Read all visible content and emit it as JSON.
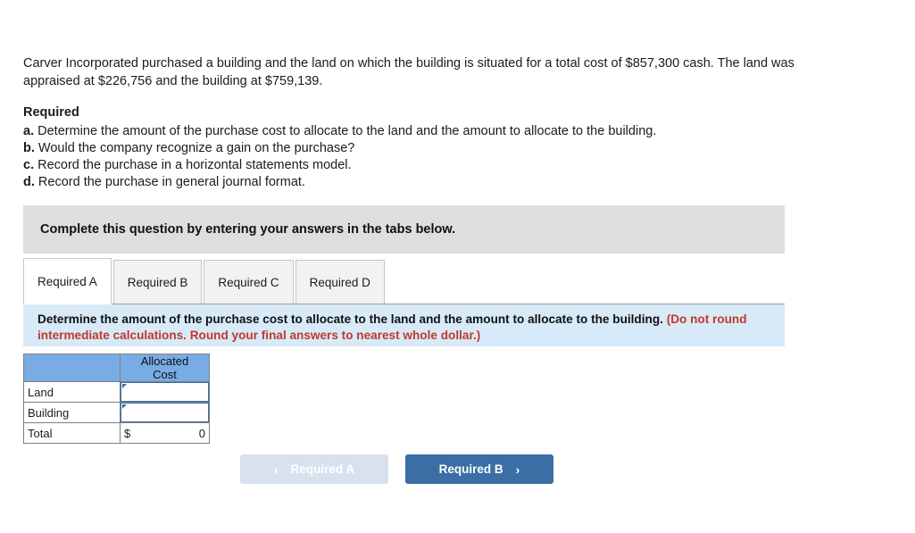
{
  "problem": {
    "text": "Carver Incorporated purchased a building and the land on which the building is situated for a total cost of $857,300 cash. The land was appraised at $226,756 and the building at $759,139."
  },
  "required": {
    "title": "Required",
    "items": [
      {
        "letter": "a.",
        "text": "Determine the amount of the purchase cost to allocate to the land and the amount to allocate to the building."
      },
      {
        "letter": "b.",
        "text": "Would the company recognize a gain on the purchase?"
      },
      {
        "letter": "c.",
        "text": "Record the purchase in a horizontal statements model."
      },
      {
        "letter": "d.",
        "text": "Record the purchase in general journal format."
      }
    ]
  },
  "instruction_bar": {
    "text": "Complete this question by entering your answers in the tabs below."
  },
  "tabs": [
    {
      "label": "Required A",
      "active": true
    },
    {
      "label": "Required B",
      "active": false
    },
    {
      "label": "Required C",
      "active": false
    },
    {
      "label": "Required D",
      "active": false
    }
  ],
  "info_panel": {
    "main_text": "Determine the amount of the purchase cost to allocate to the land and the amount to allocate to the building.",
    "note_text": "(Do not round intermediate calculations. Round your final answers to nearest whole dollar.)",
    "note_color": "#c0392b"
  },
  "answer_table": {
    "header": {
      "blank": "",
      "allocated_cost_line1": "Allocated",
      "allocated_cost_line2": "Cost"
    },
    "rows": [
      {
        "label": "Land",
        "value": "",
        "type": "input"
      },
      {
        "label": "Building",
        "value": "",
        "type": "input"
      }
    ],
    "total": {
      "label": "Total",
      "currency": "$",
      "value": "0"
    },
    "header_color": "#79ace5",
    "input_border_color": "#3a6ea5"
  },
  "nav": {
    "prev_label": "Required A",
    "prev_chevron": "‹",
    "next_label": "Required B",
    "next_chevron": "›",
    "prev_color": "#d9e1ee",
    "next_color": "#3a6ea5"
  }
}
